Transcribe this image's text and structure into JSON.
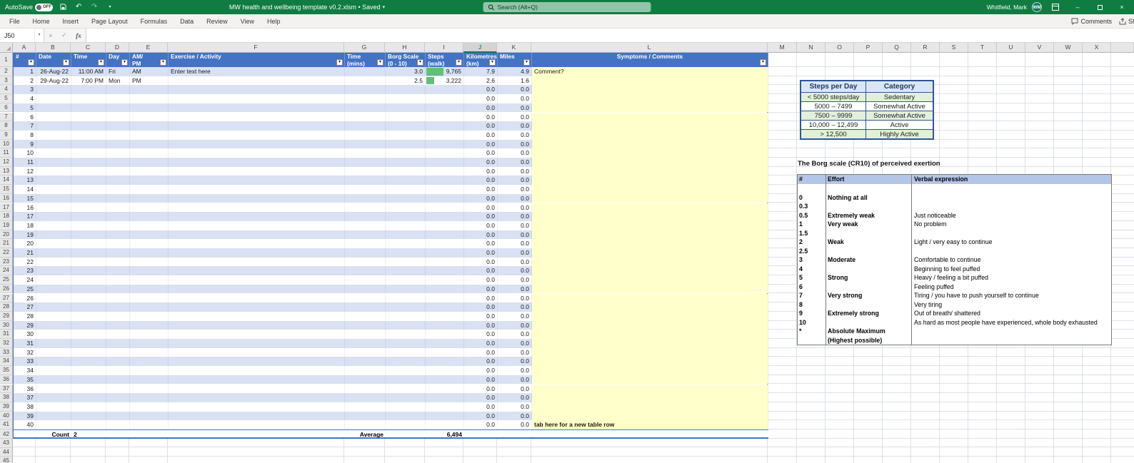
{
  "colors": {
    "titlebar": "#107C41",
    "tableheader": "#4472C4",
    "tableborder": "#4472C4",
    "band": "#D9E1F2",
    "cellyellow": "#FFFFCC",
    "stepsbar": "#63BE7B",
    "green": "#E2EFDA",
    "stepshdr": "#DAE7F3",
    "stepsborder": "#2F5597",
    "borghdr": "#B4C6E7"
  },
  "title_bar": {
    "autosave_label": "AutoSave",
    "autosave_state": "OFF",
    "doc_title": "MW health and wellbeing template v0.2.xlsm • Saved",
    "search_placeholder": "Search (Alt+Q)",
    "user_name": "Whitfield, Mark",
    "user_initials": "WM"
  },
  "ribbon": {
    "tabs": [
      "File",
      "Home",
      "Insert",
      "Page Layout",
      "Formulas",
      "Data",
      "Review",
      "View",
      "Help"
    ],
    "comments_label": "Comments",
    "share_label": "Share"
  },
  "formula_bar": {
    "name_box": "J50",
    "fx_label": "fx",
    "formula_value": ""
  },
  "sheet": {
    "columns": [
      "A",
      "B",
      "C",
      "D",
      "E",
      "F",
      "G",
      "H",
      "I",
      "J",
      "K",
      "L",
      "M",
      "N",
      "O",
      "P",
      "Q",
      "R",
      "S",
      "T",
      "U",
      "V",
      "W",
      "X",
      ""
    ],
    "selected_column": "J",
    "selected_cell": "J50",
    "first_visible_row": 1
  },
  "main_table": {
    "headers": [
      {
        "field": "n",
        "label": "#"
      },
      {
        "field": "date",
        "label": "Date"
      },
      {
        "field": "time",
        "label": "Time"
      },
      {
        "field": "day",
        "label": "Day"
      },
      {
        "field": "ampm",
        "label": "AM/\nPM"
      },
      {
        "field": "exercise",
        "label": "Exercise / Activity"
      },
      {
        "field": "mins",
        "label": "Time\n(mins)"
      },
      {
        "field": "borg",
        "label": "Borg Scale\n(0 - 10)"
      },
      {
        "field": "steps",
        "label": "Steps\n(walk)"
      },
      {
        "field": "km",
        "label": "Kilometres\n(km)"
      },
      {
        "field": "miles",
        "label": "Miles"
      },
      {
        "field": "comments",
        "label": "Symptoms / Comments"
      }
    ],
    "rows": [
      {
        "n": "1",
        "date": "26-Aug-22",
        "time": "11:00 AM",
        "day": "Fri",
        "ampm": "AM",
        "exercise": "Enter text here",
        "borg": "3.0",
        "steps": "9,765",
        "steps_bar_pct": 45,
        "km": "7.9",
        "miles": "4.9",
        "comments": "Comment?"
      },
      {
        "n": "2",
        "date": "29-Aug-22",
        "time": "7:00 PM",
        "day": "Mon",
        "ampm": "PM",
        "borg": "2.5",
        "steps": "3,222",
        "steps_bar_pct": 20,
        "km": "2.6",
        "miles": "1.6"
      },
      {
        "n": "3",
        "km": "0.0",
        "miles": "0.0"
      },
      {
        "n": "4",
        "km": "0.0",
        "miles": "0.0"
      },
      {
        "n": "5",
        "km": "0.0",
        "miles": "0.0"
      },
      {
        "n": "6",
        "km": "0.0",
        "miles": "0.0"
      },
      {
        "n": "7",
        "km": "0.0",
        "miles": "0.0"
      },
      {
        "n": "8",
        "km": "0.0",
        "miles": "0.0"
      },
      {
        "n": "9",
        "km": "0.0",
        "miles": "0.0"
      },
      {
        "n": "10",
        "km": "0.0",
        "miles": "0.0"
      },
      {
        "n": "11",
        "km": "0.0",
        "miles": "0.0"
      },
      {
        "n": "12",
        "km": "0.0",
        "miles": "0.0"
      },
      {
        "n": "13",
        "km": "0.0",
        "miles": "0.0"
      },
      {
        "n": "14",
        "km": "0.0",
        "miles": "0.0"
      },
      {
        "n": "15",
        "km": "0.0",
        "miles": "0.0"
      },
      {
        "n": "16",
        "km": "0.0",
        "miles": "0.0"
      },
      {
        "n": "17",
        "km": "0.0",
        "miles": "0.0"
      },
      {
        "n": "18",
        "km": "0.0",
        "miles": "0.0"
      },
      {
        "n": "19",
        "km": "0.0",
        "miles": "0.0"
      },
      {
        "n": "20",
        "km": "0.0",
        "miles": "0.0"
      },
      {
        "n": "21",
        "km": "0.0",
        "miles": "0.0"
      },
      {
        "n": "22",
        "km": "0.0",
        "miles": "0.0"
      },
      {
        "n": "23",
        "km": "0.0",
        "miles": "0.0"
      },
      {
        "n": "24",
        "km": "0.0",
        "miles": "0.0"
      },
      {
        "n": "25",
        "km": "0.0",
        "miles": "0.0"
      },
      {
        "n": "26",
        "km": "0.0",
        "miles": "0.0"
      },
      {
        "n": "27",
        "km": "0.0",
        "miles": "0.0"
      },
      {
        "n": "28",
        "km": "0.0",
        "miles": "0.0"
      },
      {
        "n": "29",
        "km": "0.0",
        "miles": "0.0"
      },
      {
        "n": "30",
        "km": "0.0",
        "miles": "0.0"
      },
      {
        "n": "31",
        "km": "0.0",
        "miles": "0.0"
      },
      {
        "n": "32",
        "km": "0.0",
        "miles": "0.0"
      },
      {
        "n": "33",
        "km": "0.0",
        "miles": "0.0"
      },
      {
        "n": "34",
        "km": "0.0",
        "miles": "0.0"
      },
      {
        "n": "35",
        "km": "0.0",
        "miles": "0.0"
      },
      {
        "n": "36",
        "km": "0.0",
        "miles": "0.0"
      },
      {
        "n": "37",
        "km": "0.0",
        "miles": "0.0"
      },
      {
        "n": "38",
        "km": "0.0",
        "miles": "0.0"
      },
      {
        "n": "39",
        "km": "0.0",
        "miles": "0.0"
      },
      {
        "n": "40",
        "km": "0.0",
        "miles": "0.0",
        "comments": "tab here for a new table row",
        "comments_bold": true
      }
    ],
    "summary": {
      "count_label": "Count",
      "count_value": "2",
      "average_label": "Average",
      "average_value": "6,494"
    }
  },
  "steps_table": {
    "headers": [
      "Steps per Day",
      "Category"
    ],
    "rows": [
      [
        "< 5000 steps/day",
        "Sedentary"
      ],
      [
        "5000 – 7499",
        "Somewhat Active"
      ],
      [
        "7500 – 9999",
        "Somewhat Active"
      ],
      [
        "10,000 – 12,499",
        "Active"
      ],
      [
        "> 12,500",
        "Highly Active"
      ]
    ]
  },
  "borg": {
    "title": "The Borg scale (CR10) of perceived exertion",
    "headers": [
      "#",
      "Effort",
      "Verbal expression"
    ],
    "rows": [
      [
        "",
        "",
        ""
      ],
      [
        "0",
        "Nothing at all",
        ""
      ],
      [
        "0.3",
        "",
        ""
      ],
      [
        "0.5",
        "Extremely weak",
        "Just noticeable"
      ],
      [
        "1",
        "Very weak",
        "No problem"
      ],
      [
        "1.5",
        "",
        ""
      ],
      [
        "2",
        "Weak",
        "Light / very easy to continue"
      ],
      [
        "2.5",
        "",
        ""
      ],
      [
        "3",
        "Moderate",
        "Comfortable to continue"
      ],
      [
        "4",
        "",
        "Beginning to feel puffed"
      ],
      [
        "5",
        "Strong",
        "Heavy / feeling a bit puffed"
      ],
      [
        "6",
        "",
        "Feeling puffed"
      ],
      [
        "7",
        "Very strong",
        "Tiring / you have to push yourself to continue"
      ],
      [
        "8",
        "",
        "Very tiring"
      ],
      [
        "9",
        "Extremely strong",
        "Out of breath/ shattered"
      ],
      [
        "10",
        "",
        "As hard as most people have experienced, whole body exhausted"
      ],
      [
        "*",
        "Absolute Maximum",
        ""
      ],
      [
        "",
        "(Highest possible)",
        ""
      ]
    ]
  }
}
